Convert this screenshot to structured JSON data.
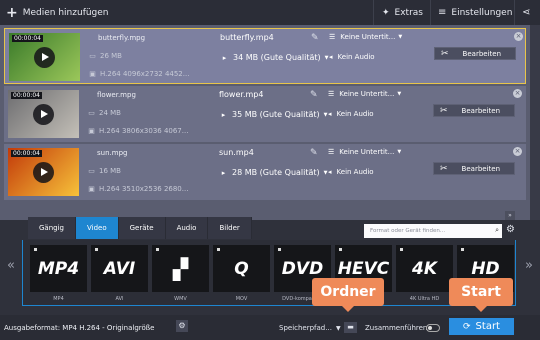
{
  "toolbar": {
    "add_media": "Medien hinzufügen",
    "extras": "Extras",
    "settings": "Einstellungen"
  },
  "files": [
    {
      "duration": "00:00:04",
      "name": "butterfly.mpg",
      "size": "26 MB",
      "info": "H.264 4096x2732 4452...",
      "out_name": "butterfly.mp4",
      "out_size": "34 MB (Gute Qualität)",
      "subtitles": "Keine Untertit...",
      "audio": "Kein Audio",
      "edit": "Bearbeiten",
      "selected": true,
      "thumb_colors": [
        "#3a7a2a",
        "#9bc75a"
      ]
    },
    {
      "duration": "00:00:04",
      "name": "flower.mpg",
      "size": "24 MB",
      "info": "H.264 3806x3036 4067...",
      "out_name": "flower.mp4",
      "out_size": "35 MB (Gute Qualität)",
      "subtitles": "Keine Untertit...",
      "audio": "Kein Audio",
      "edit": "Bearbeiten",
      "selected": false,
      "thumb_colors": [
        "#6d6d70",
        "#c4c0b8"
      ]
    },
    {
      "duration": "00:00:04",
      "name": "sun.mpg",
      "size": "16 MB",
      "info": "H.264 3510x2536 2680...",
      "out_name": "sun.mp4",
      "out_size": "28 MB (Gute Qualität)",
      "subtitles": "Keine Untertit...",
      "audio": "Kein Audio",
      "edit": "Bearbeiten",
      "selected": false,
      "thumb_colors": [
        "#c23a0a",
        "#f7c23a"
      ]
    }
  ],
  "tabs": [
    "Gängig",
    "Video",
    "Geräte",
    "Audio",
    "Bilder"
  ],
  "active_tab": "Video",
  "search_placeholder": "Format oder Gerät finden...",
  "formats": [
    {
      "logo": "MP4",
      "label": "MP4"
    },
    {
      "logo": "AVI",
      "label": "AVI"
    },
    {
      "logo": "",
      "label": "WMV"
    },
    {
      "logo": "Q",
      "label": "MOV"
    },
    {
      "logo": "DVD",
      "label": "DVD-kompatibel"
    },
    {
      "logo": "HEVC",
      "label": "H.265"
    },
    {
      "logo": "4K",
      "label": "4K Ultra HD"
    },
    {
      "logo": "HD",
      "label": ""
    }
  ],
  "status": {
    "output_format": "Ausgabeformat: MP4 H.264 - Originalgröße",
    "save_path": "Speicherpfad...",
    "merge": "Zusammenführen",
    "start": "Start"
  },
  "callouts": {
    "folder": "Ordner",
    "start": "Start"
  },
  "colors": {
    "accent": "#1e86d0",
    "start_button": "#2a8ee0",
    "callout": "#ef8a59",
    "selection": "#e8c54a"
  }
}
